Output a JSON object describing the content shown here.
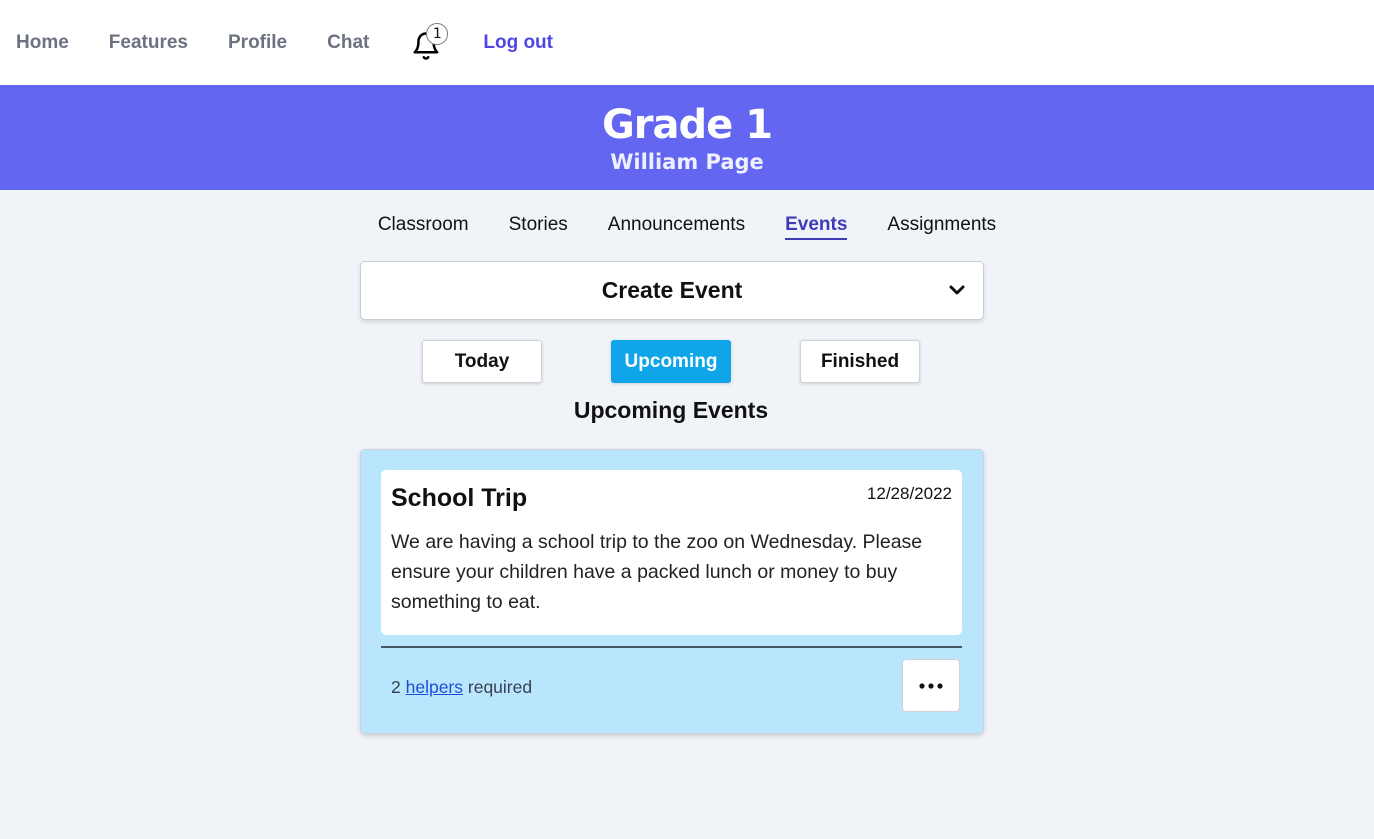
{
  "nav": {
    "items": [
      {
        "label": "Home"
      },
      {
        "label": "Features"
      },
      {
        "label": "Profile"
      },
      {
        "label": "Chat"
      }
    ],
    "notification_count": "1",
    "logout_label": "Log out"
  },
  "banner": {
    "title": "Grade 1",
    "subtitle": "William Page"
  },
  "tabs": [
    {
      "label": "Classroom"
    },
    {
      "label": "Stories"
    },
    {
      "label": "Announcements"
    },
    {
      "label": "Events",
      "active": true
    },
    {
      "label": "Assignments"
    }
  ],
  "create_event": {
    "label": "Create Event",
    "icon": "chevron-down-icon"
  },
  "filters": {
    "today": "Today",
    "upcoming": "Upcoming",
    "finished": "Finished",
    "selected": "Upcoming"
  },
  "section_title": "Upcoming Events",
  "event": {
    "title": "School Trip",
    "date": "12/28/2022",
    "description": "We are having a school trip to the zoo on Wednesday. Please ensure your children have a packed lunch or money to buy something to eat.",
    "helpers_count": "2",
    "helpers_link": "helpers",
    "helpers_suffix": "required"
  },
  "colors": {
    "accent": "#6366f1",
    "active_filter": "#0ea5e9",
    "event_card_bg": "#bae6fd",
    "page_bg": "#f0f3f8"
  }
}
